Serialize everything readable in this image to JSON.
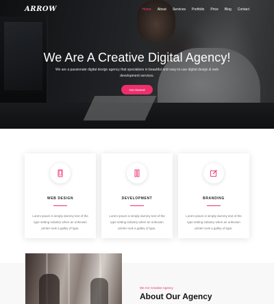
{
  "header": {
    "logo": "ARROW",
    "nav": [
      {
        "label": "Home",
        "active": true
      },
      {
        "label": "About",
        "active": false
      },
      {
        "label": "Services",
        "active": false
      },
      {
        "label": "Portfolio",
        "active": false
      },
      {
        "label": "Price",
        "active": false
      },
      {
        "label": "Blog",
        "active": false
      },
      {
        "label": "Contact",
        "active": false
      }
    ]
  },
  "hero": {
    "title": "We Are A Creative Digital Agency!",
    "subtitle": "We are a passionate digital design agency that specializes in beautiful and easy-to-use digital design & web development services.",
    "button": "Get Started"
  },
  "features": [
    {
      "icon": "tablet-icon",
      "title": "WEB DESIGN",
      "text": "Lorem ipsum is simply dummy text of the type setting industry when an unknown printer took a galley of type."
    },
    {
      "icon": "pencils-icon",
      "title": "DEVELOPMENT",
      "text": "Lorem ipsum is simply dummy text of the type setting industry when an unknown printer took a galley of type."
    },
    {
      "icon": "edit-icon",
      "title": "BRANDING",
      "text": "Lorem ipsum is simply dummy text of the type setting industry when an unknown printer took a galley of type."
    }
  ],
  "about": {
    "kicker": "We Are Creative Agency",
    "title": "About Our Agency"
  },
  "colors": {
    "accent": "#ed2f6c",
    "text": "#333333",
    "muted": "#777777"
  }
}
